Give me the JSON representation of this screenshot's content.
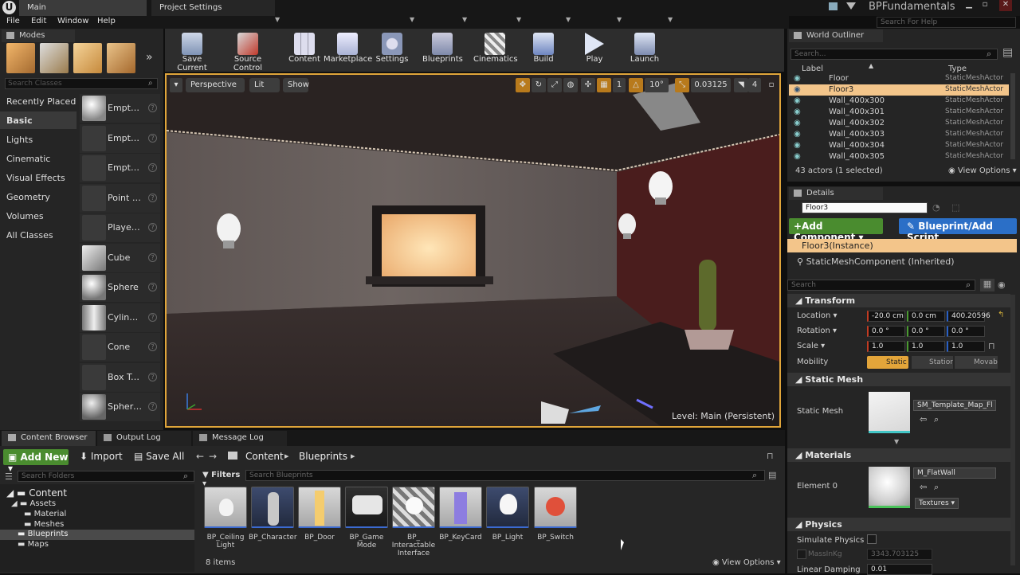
{
  "titlebar": {
    "tabs": [
      {
        "label": "Main"
      },
      {
        "label": "Project Settings"
      }
    ],
    "project_name": "BPFundamentals",
    "help_search_placeholder": "Search For Help",
    "menu": [
      "File",
      "Edit",
      "Window",
      "Help"
    ]
  },
  "modes": {
    "title": "Modes",
    "search_placeholder": "Search Classes",
    "categories": [
      "Recently Placed",
      "Basic",
      "Lights",
      "Cinematic",
      "Visual Effects",
      "Geometry",
      "Volumes",
      "All Classes"
    ],
    "selected_category": "Basic",
    "placeables": [
      "Empty Ac",
      "Empty Ch",
      "Empty Pa",
      "Point Ligh",
      "Player St",
      "Cube",
      "Sphere",
      "Cylinder",
      "Cone",
      "Box Trigg",
      "Sphere T"
    ]
  },
  "toolbar": {
    "buttons": [
      "Save Current",
      "Source Control",
      "Content",
      "Marketplace",
      "Settings",
      "Blueprints",
      "Cinematics",
      "Build",
      "Play",
      "Launch"
    ]
  },
  "viewport": {
    "perspective": "Perspective",
    "lit": "Lit",
    "show": "Show",
    "grid_snap": "1",
    "rot_snap": "10°",
    "scale_snap": "0.03125",
    "cam_speed": "4",
    "level_label": "Level:",
    "level_name": "Main (Persistent)"
  },
  "outliner": {
    "title": "World Outliner",
    "search_placeholder": "Search...",
    "col_label": "Label",
    "col_type": "Type",
    "rows": [
      {
        "label": "Floor",
        "type": "StaticMeshActor"
      },
      {
        "label": "Floor3",
        "type": "StaticMeshActor"
      },
      {
        "label": "Wall_400x300",
        "type": "StaticMeshActor"
      },
      {
        "label": "Wall_400x301",
        "type": "StaticMeshActor"
      },
      {
        "label": "Wall_400x302",
        "type": "StaticMeshActor"
      },
      {
        "label": "Wall_400x303",
        "type": "StaticMeshActor"
      },
      {
        "label": "Wall_400x304",
        "type": "StaticMeshActor"
      },
      {
        "label": "Wall_400x305",
        "type": "StaticMeshActor"
      }
    ],
    "status": "43 actors (1 selected)",
    "view_options": "View Options"
  },
  "details": {
    "title": "Details",
    "actor_name": "Floor3",
    "add_component": "+Add Component",
    "blueprint_script": "Blueprint/Add Script",
    "instance": "Floor3(Instance)",
    "component": "StaticMeshComponent (Inherited)",
    "search_placeholder": "Search",
    "transform_title": "Transform",
    "location_label": "Location",
    "rotation_label": "Rotation",
    "scale_label": "Scale",
    "mobility_label": "Mobility",
    "location": [
      "-20.0 cm",
      "0.0 cm",
      "400.20596"
    ],
    "rotation": [
      "0.0 °",
      "0.0 °",
      "0.0 °"
    ],
    "scale": [
      "1.0",
      "1.0",
      "1.0"
    ],
    "mobility": [
      "Static",
      "Statior",
      "Movab"
    ],
    "static_mesh_title": "Static Mesh",
    "static_mesh_label": "Static Mesh",
    "static_mesh_value": "SM_Template_Map_Fl",
    "materials_title": "Materials",
    "element0_label": "Element 0",
    "material_value": "M_FlatWall",
    "textures": "Textures",
    "physics_title": "Physics",
    "simulate_physics": "Simulate Physics",
    "mass_label": "MassInKg",
    "mass_value": "3343.703125",
    "linear_damping": "Linear Damping",
    "linear_damping_value": "0.01"
  },
  "content_browser": {
    "tabs": [
      "Content Browser",
      "Output Log",
      "Message Log"
    ],
    "add_new": "Add New",
    "import": "Import",
    "save_all": "Save All",
    "path": [
      "Content",
      "Blueprints"
    ],
    "search_folders_placeholder": "Search Folders",
    "filters": "Filters",
    "search_bp_placeholder": "Search Blueprints",
    "tree": [
      {
        "label": "Content",
        "depth": 0
      },
      {
        "label": "Assets",
        "depth": 1
      },
      {
        "label": "Material",
        "depth": 2
      },
      {
        "label": "Meshes",
        "depth": 2
      },
      {
        "label": "Blueprints",
        "depth": 1
      },
      {
        "label": "Maps",
        "depth": 1
      }
    ],
    "assets": [
      "BP_Ceiling Light",
      "BP_Character",
      "BP_Door",
      "BP_Game Mode",
      "BP_ Interactable Interface",
      "BP_KeyCard",
      "BP_Light",
      "BP_Switch"
    ],
    "count": "8 items",
    "view_options": "View Options"
  },
  "colors": {
    "accent_orange": "#e0a53a",
    "selected_row": "#f3c58a",
    "green_button": "#4a8c2f",
    "blue_button": "#2b6fc7"
  }
}
